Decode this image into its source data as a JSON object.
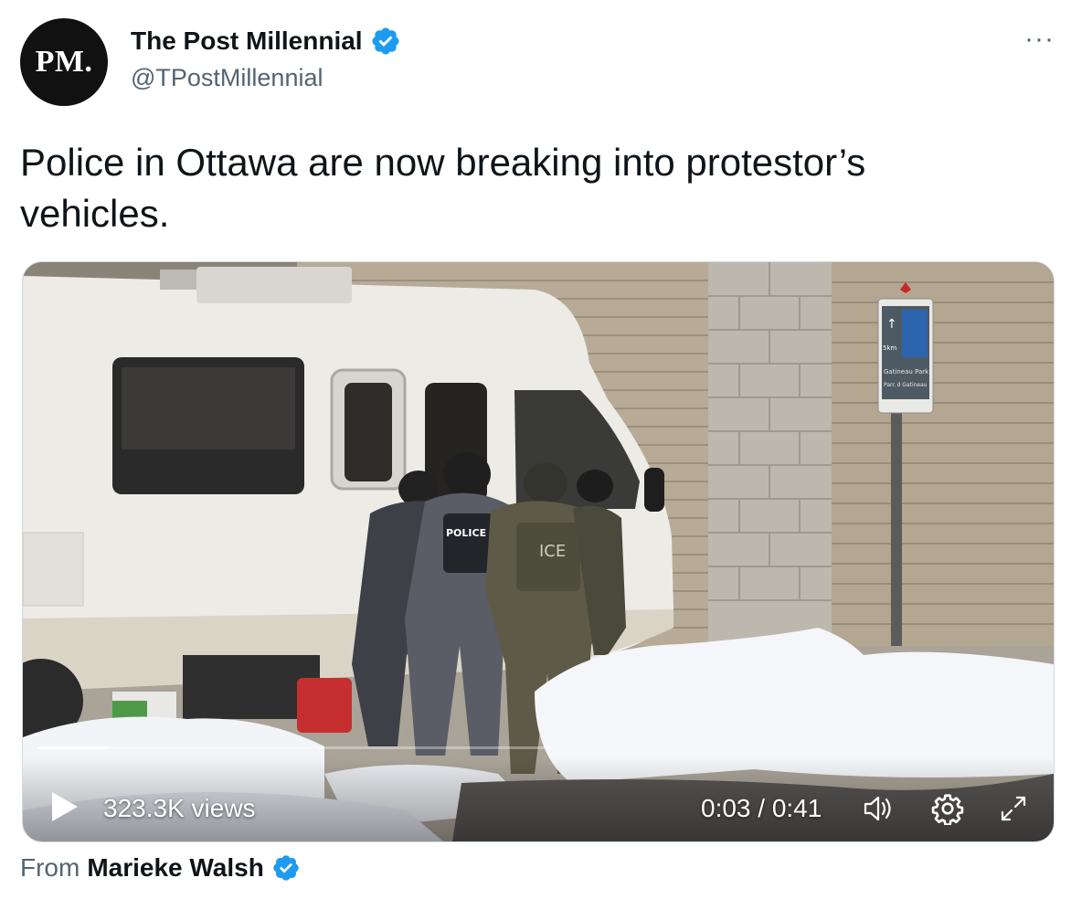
{
  "author": {
    "avatar_text": "PM.",
    "display_name": "The Post Millennial",
    "handle": "@TPostMillennial",
    "verified": true
  },
  "menu": {
    "more_label": "···"
  },
  "tweet": {
    "text": "Police in Ottawa are now breaking into protestor’s vehicles."
  },
  "video": {
    "views": "323.3K views",
    "time": "0:03 / 0:41",
    "progress": 0.07,
    "scene_text": {
      "vest_label": "POLICE",
      "vest_label_2": "ICE",
      "sign_distance": "5km",
      "sign_line_1": "Gatineau Park",
      "sign_line_2": "Parc d Gatineau"
    }
  },
  "attribution": {
    "prefix": "From",
    "name": "Marieke Walsh",
    "verified": true
  },
  "colors": {
    "verified_blue": "#1d9bf0",
    "text_primary": "#0f1419",
    "text_secondary": "#536471"
  }
}
